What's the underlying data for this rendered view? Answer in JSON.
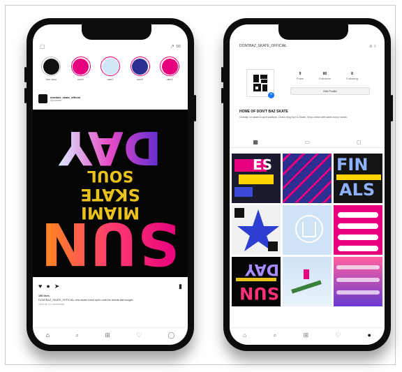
{
  "feed": {
    "stories": [
      {
        "label": "Your story",
        "color": "#111111"
      },
      {
        "label": "user1",
        "color": "#e6007e"
      },
      {
        "label": "user2",
        "color": "#cfe6f7"
      },
      {
        "label": "user3",
        "color": "#2b2f8f"
      },
      {
        "label": "user4",
        "color": "#e6007e"
      }
    ],
    "post": {
      "username": "dontbaz_skate_official",
      "subtitle": "Sponsored",
      "art": {
        "line1": "DAY",
        "line2": "SOUL",
        "line3": "SKATE",
        "line4": "MIAMI",
        "line5": "SUN"
      },
      "likes": "156 likes",
      "caption": "DONTBAZ_SKATE_OFFICIAL new skate event open until the tickets last bought.",
      "comments": "View all 12 comments"
    },
    "nav": [
      "home-icon",
      "search-icon",
      "add-icon",
      "heart-icon",
      "profile-icon"
    ]
  },
  "profile": {
    "handle": "DONTBAZ_SKATE_OFFICIAL",
    "stats": [
      {
        "num": "9",
        "label": "Posts"
      },
      {
        "num": "80",
        "label": "Followers"
      },
      {
        "num": "8",
        "label": "Following"
      }
    ],
    "edit_label": "Edit Profile",
    "name": "HOME OF DON'T BAZ SKATE",
    "bio": "Globally on skate & sport platform. Check blog Surf & Skate. Shop online with sales every month.",
    "grid_texts": {
      "finals_1": "FIN",
      "finals_2": "ALS",
      "sun": "SUN",
      "day": "DAY",
      "tile_es": "ES"
    }
  }
}
